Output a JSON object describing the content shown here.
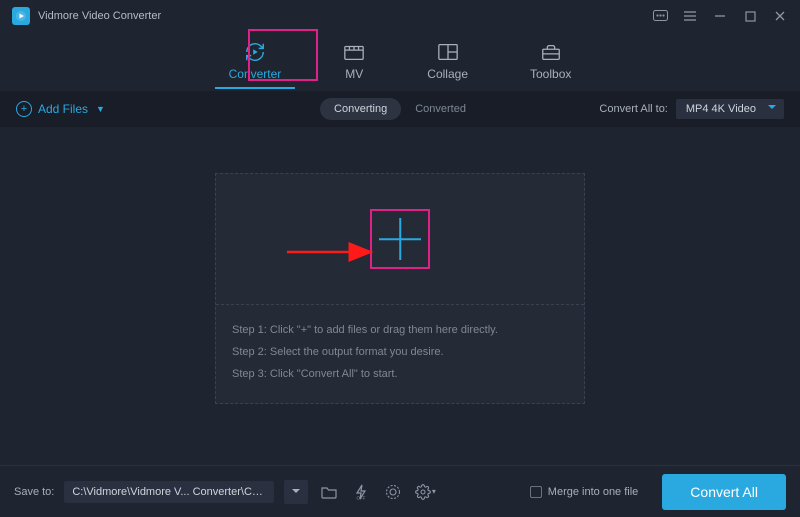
{
  "app": {
    "title": "Vidmore Video Converter"
  },
  "tabs": {
    "converter": "Converter",
    "mv": "MV",
    "collage": "Collage",
    "toolbox": "Toolbox"
  },
  "toolbar": {
    "add_files": "Add Files",
    "sub_converting": "Converting",
    "sub_converted": "Converted",
    "convert_all_to": "Convert All to:",
    "format": "MP4 4K Video"
  },
  "steps": {
    "s1": "Step 1: Click \"+\" to add files or drag them here directly.",
    "s2": "Step 2: Select the output format you desire.",
    "s3": "Step 3: Click \"Convert All\" to start."
  },
  "bottom": {
    "save_to": "Save to:",
    "path": "C:\\Vidmore\\Vidmore V... Converter\\Converted",
    "merge": "Merge into one file",
    "convert_all": "Convert All"
  }
}
